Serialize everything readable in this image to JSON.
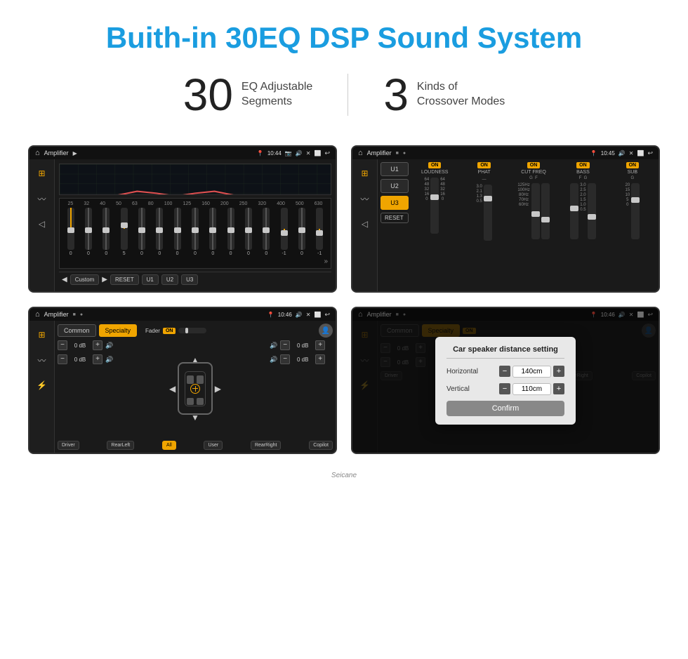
{
  "page": {
    "title": "Buith-in 30EQ DSP Sound System",
    "title_color": "#1a9de0",
    "stat1_number": "30",
    "stat1_label": "EQ Adjustable\nSegments",
    "stat2_number": "3",
    "stat2_label": "Kinds of\nCrossover Modes"
  },
  "screens": {
    "screen1": {
      "status": {
        "title": "Amplifier",
        "time": "10:44"
      },
      "eq_freq": [
        "25",
        "32",
        "40",
        "50",
        "63",
        "80",
        "100",
        "125",
        "160",
        "200",
        "250",
        "320",
        "400",
        "500",
        "630"
      ],
      "eq_values": [
        "0",
        "0",
        "0",
        "0",
        "5",
        "0",
        "0",
        "0",
        "0",
        "0",
        "0",
        "0",
        "0",
        "-1",
        "0",
        "-1"
      ],
      "buttons": [
        "Custom",
        "RESET",
        "U1",
        "U2",
        "U3"
      ]
    },
    "screen2": {
      "status": {
        "title": "Amplifier",
        "time": "10:45"
      },
      "presets": [
        "U1",
        "U2",
        "U3"
      ],
      "channels": [
        "LOUDNESS",
        "PHAT",
        "CUT FREQ",
        "BASS",
        "SUB"
      ],
      "reset_label": "RESET"
    },
    "screen3": {
      "status": {
        "title": "Amplifier",
        "time": "10:46"
      },
      "tabs": [
        "Common",
        "Specialty"
      ],
      "fader_label": "Fader",
      "on_label": "ON",
      "speakers": {
        "fl": "0 dB",
        "fr": "0 dB",
        "rl": "0 dB",
        "rr": "0 dB"
      },
      "buttons": {
        "driver": "Driver",
        "rear_left": "RearLeft",
        "all": "All",
        "user": "User",
        "rear_right": "RearRight",
        "copilot": "Copilot"
      }
    },
    "screen4": {
      "status": {
        "title": "Amplifier",
        "time": "10:46"
      },
      "tabs": [
        "Common",
        "Specialty"
      ],
      "on_label": "ON",
      "dialog": {
        "title": "Car speaker distance setting",
        "horizontal_label": "Horizontal",
        "horizontal_value": "140cm",
        "vertical_label": "Vertical",
        "vertical_value": "110cm",
        "confirm_label": "Confirm"
      },
      "speakers": {
        "fr": "0 dB",
        "rr": "0 dB"
      },
      "buttons": {
        "driver": "Driver",
        "rear_left": "RearLeft",
        "all": "All",
        "rear_right": "RearRight",
        "copilot": "Copilot"
      }
    }
  },
  "watermark": "Seicane"
}
